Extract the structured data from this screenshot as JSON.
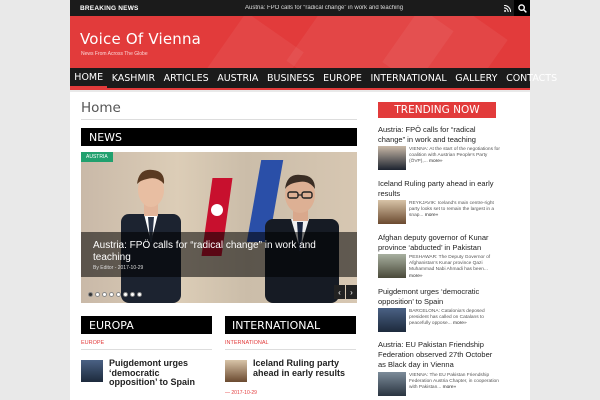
{
  "topbar": {
    "breaking_label": "BREAKING NEWS",
    "ticker_text": "Austria: FPÖ calls for “radical change” in work and teaching",
    "rss_icon": "rss-icon",
    "search_icon": "search-icon"
  },
  "header": {
    "site_title": "Voice Of Vienna",
    "tagline": "News From Across The Globe",
    "brand_color": "#e23b3b"
  },
  "nav": {
    "items": [
      "HOME",
      "KASHMIR",
      "ARTICLES",
      "AUSTRIA",
      "BUSINESS",
      "EUROPE",
      "INTERNATIONAL",
      "GALLERY",
      "CONTACTS"
    ],
    "active": "HOME"
  },
  "page": {
    "title": "Home"
  },
  "news_block": {
    "heading": "NEWS",
    "slide": {
      "category": "AUSTRIA",
      "title": "Austria: FPÖ calls for “radical change” in work and teaching",
      "author_prefix": "By",
      "author": "Editor",
      "date": "2017-10-29"
    },
    "dots_total": 8,
    "dots_active": 1,
    "prev_icon": "chevron-left-icon",
    "next_icon": "chevron-right-icon"
  },
  "europa_block": {
    "heading": "EUROPA",
    "category": "EUROPE",
    "title": "Puigdemont urges ‘democratic opposition’ to Spain"
  },
  "international_block": {
    "heading": "INTERNATIONAL",
    "category": "INTERNATIONAL",
    "title": "Iceland Ruling party ahead in early results",
    "date": "— 2017-10-29"
  },
  "trending": {
    "heading": "TRENDING NOW",
    "more_label": "more»",
    "items": [
      {
        "title": "Austria: FPÖ calls for “radical change” in work and teaching",
        "excerpt": "VIENNA: At the start of the negotiations for coalition with Austrian People’s Party (ÖVP),..."
      },
      {
        "title": "Iceland Ruling party ahead in early results",
        "excerpt": "REYKJAVIK: Iceland’s main centre-right party looks set to remain the largest in a snap..."
      },
      {
        "title": "Afghan deputy governor of Kunar province ‘abducted’ in Pakistan",
        "excerpt": "PESHAWAR: The Deputy Governor of Afghanistan’s Kunar province Qazi Muhammad Nabi Ahmadi has been..."
      },
      {
        "title": "Puigdemont urges ‘democratic opposition’ to Spain",
        "excerpt": "BARCELONA: Catalonia’s deposed president has called on Catalans to peacefully oppose..."
      },
      {
        "title": "Austria: EU Pakistan Friendship Federation observed 27th October as Black day in Vienna",
        "excerpt": "VIENNA: The EU Pakistan Friendship Federation Austria Chapter, in cooperation with Pakistan..."
      }
    ]
  }
}
